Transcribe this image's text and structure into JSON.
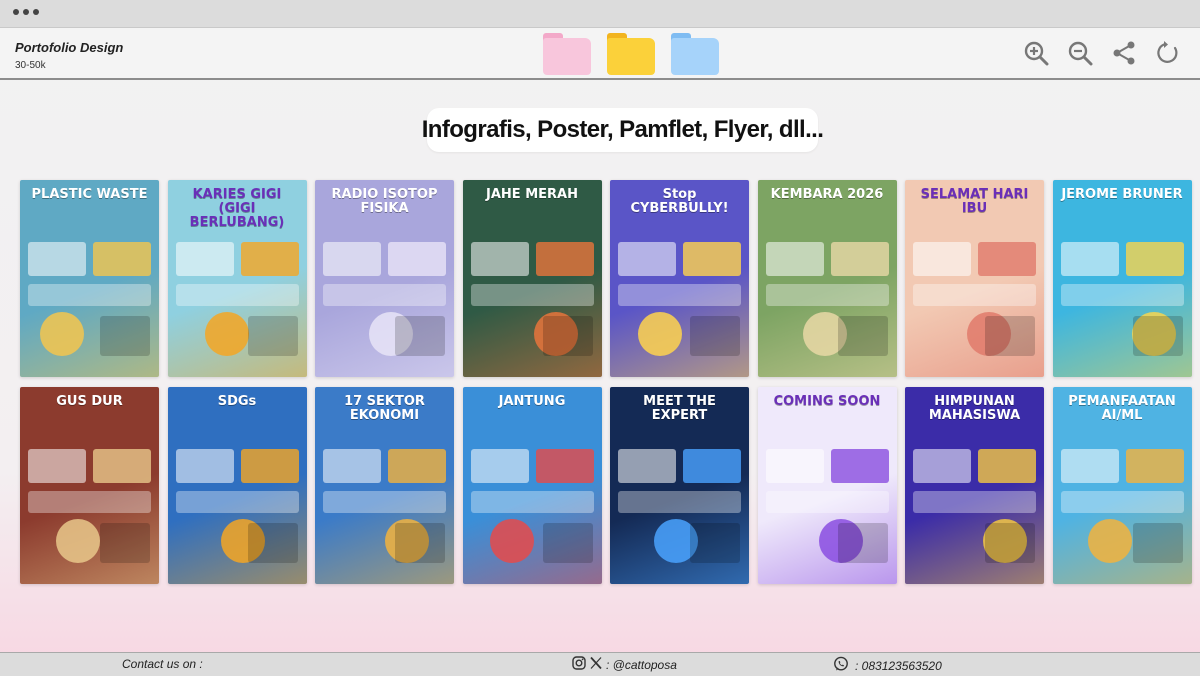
{
  "window": {
    "title": "Portofolio Design",
    "subtitle": "30-50k"
  },
  "toolbar": {
    "folders": [
      {
        "name": "pink-folder",
        "color": "#f8c6dc"
      },
      {
        "name": "yellow-folder",
        "color": "#fbd13a"
      },
      {
        "name": "blue-folder",
        "color": "#9fcff8"
      }
    ],
    "tools": [
      "zoom-in-icon",
      "zoom-out-icon",
      "share-icon",
      "rotate-icon"
    ]
  },
  "heading": "Infografis, Poster, Pamflet, Flyer, dll...",
  "gallery": {
    "posters": [
      {
        "title": "PLASTIC WASTE",
        "bg": "#5fa9c4",
        "accent": "#f4c64e"
      },
      {
        "title": "KARIES GIGI (GIGI BERLUBANG)",
        "bg": "#8fd0e0",
        "accent": "#f5a623"
      },
      {
        "title": "RADIO ISOTOP FISIKA",
        "bg": "#a9a6dc",
        "accent": "#e8e4f7"
      },
      {
        "title": "JAHE MERAH",
        "bg": "#2f5a45",
        "accent": "#e8743b"
      },
      {
        "title": "Stop CYBERBULLY!",
        "bg": "#5a55c7",
        "accent": "#ffd34e"
      },
      {
        "title": "KEMBARA 2026",
        "bg": "#7da463",
        "accent": "#e9d8a6"
      },
      {
        "title": "SELAMAT HARI IBU",
        "bg": "#f2c9b3",
        "accent": "#e07a6b"
      },
      {
        "title": "JEROME BRUNER",
        "bg": "#3db6e0",
        "accent": "#f7d54d"
      },
      {
        "title": "GUS DUR",
        "bg": "#8c3b2e",
        "accent": "#e9c88b"
      },
      {
        "title": "SDGs",
        "bg": "#2f6fc0",
        "accent": "#f5a623"
      },
      {
        "title": "17 SEKTOR EKONOMI",
        "bg": "#3b7bc8",
        "accent": "#f2b33d"
      },
      {
        "title": "JANTUNG",
        "bg": "#3a8fd8",
        "accent": "#e64a4a"
      },
      {
        "title": "MEET THE EXPERT",
        "bg": "#142a55",
        "accent": "#4aa3ff"
      },
      {
        "title": "COMING SOON",
        "bg": "#efe9fb",
        "accent": "#8a4de0"
      },
      {
        "title": "HIMPUNAN MAHASISWA",
        "bg": "#3b2ca8",
        "accent": "#f5c842"
      },
      {
        "title": "PEMANFAATAN AI/ML",
        "bg": "#4fb3e3",
        "accent": "#f2b33d"
      }
    ]
  },
  "footer": {
    "contact_label": "Contact us on :",
    "social_handle": ": @cattoposa",
    "phone": ": 083123563520"
  }
}
